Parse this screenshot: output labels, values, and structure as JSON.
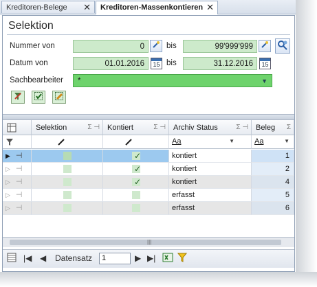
{
  "tabs": [
    {
      "label": "Kreditoren-Belege",
      "active": false
    },
    {
      "label": "Kreditoren-Massenkontieren",
      "active": true
    }
  ],
  "close_glyph": "✕",
  "selection": {
    "title": "Selektion",
    "nummer_label": "Nummer von",
    "nummer_from": "0",
    "nummer_bis_label": "bis",
    "nummer_to": "99'999'999",
    "datum_label": "Datum von",
    "datum_from": "01.01.2016",
    "datum_bis_label": "bis",
    "datum_to": "31.12.2016",
    "sachbearbeiter_label": "Sachbearbeiter",
    "sachbearbeiter_value": "*",
    "calendar_glyph": "15"
  },
  "grid": {
    "columns": [
      "Selektion",
      "Kontiert",
      "Archiv Status",
      "Beleg"
    ],
    "sigma": "Σ ⊣",
    "filter_text": "Aa",
    "rows": [
      {
        "kontiert": true,
        "status": "kontiert",
        "beleg": "1",
        "selected": true
      },
      {
        "kontiert": true,
        "status": "kontiert",
        "beleg": "2",
        "selected": false
      },
      {
        "kontiert": true,
        "status": "kontiert",
        "beleg": "4",
        "selected": false
      },
      {
        "kontiert": false,
        "status": "erfasst",
        "beleg": "5",
        "selected": false
      },
      {
        "kontiert": false,
        "status": "erfasst",
        "beleg": "6",
        "selected": false
      }
    ]
  },
  "navigator": {
    "label": "Datensatz",
    "value": "1"
  },
  "colors": {
    "field_light": "#cdeacb",
    "field_bright": "#6ed36c",
    "row_selected": "#9cc9ef",
    "row_alt": "#e6e6e6"
  }
}
